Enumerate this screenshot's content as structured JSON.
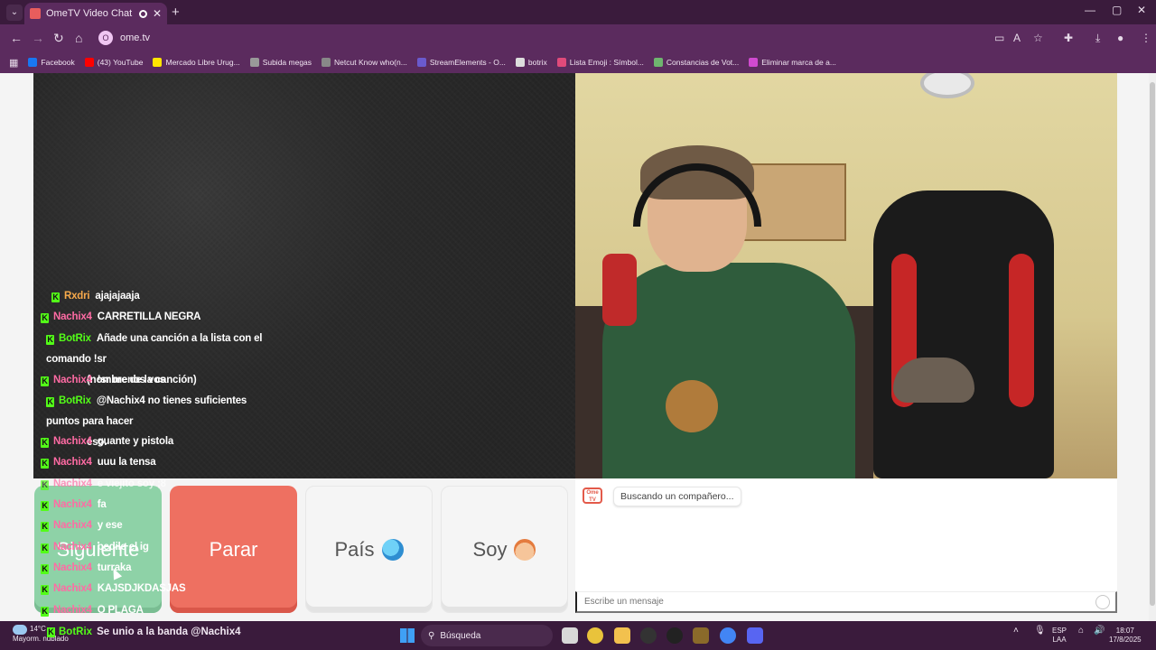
{
  "browser": {
    "tab_title": "OmeTV Video Chat — Ome",
    "tab_close": "✕",
    "new_tab": "+",
    "address": "ome.tv",
    "window_controls": {
      "minimize": "—",
      "maximize": "▢",
      "close": "✕"
    },
    "bookmarks": [
      {
        "label": "Facebook",
        "color": "#1877f2"
      },
      {
        "label": "(43) YouTube",
        "color": "#ff0000"
      },
      {
        "label": "Mercado Libre Urug...",
        "color": "#ffe600"
      },
      {
        "label": "Subida megas",
        "color": "#999999"
      },
      {
        "label": "Netcut Know who(n...",
        "color": "#888888"
      },
      {
        "label": "StreamElements - O...",
        "color": "#6a5acd"
      },
      {
        "label": "botrix",
        "color": "#dddddd"
      },
      {
        "label": "Lista Emoji : Símbol...",
        "color": "#e04a7a"
      },
      {
        "label": "Constancias de Vot...",
        "color": "#6fb46f"
      },
      {
        "label": "Eliminar marca de a...",
        "color": "#d04ad0"
      }
    ]
  },
  "chat_overlay": {
    "badge": "K",
    "messages": [
      {
        "user": "Rxdri",
        "color": "#f7a94b",
        "text": "ajajajaaja"
      },
      {
        "user": "Nachix4",
        "color": "#ff6ba4",
        "text": "CARRETILLA NEGRA"
      },
      {
        "user": "BotRix",
        "color": "#53fc18",
        "text": "Añade una canción a la lista con el comando !sr",
        "text2": "(nombre de la canción)"
      },
      {
        "user": "Nachix4",
        "color": "#ff6ba4",
        "text": "!sr menos vos"
      },
      {
        "user": "BotRix",
        "color": "#53fc18",
        "text": "@Nachix4 no tienes suficientes puntos para hacer",
        "text2": "eso."
      },
      {
        "user": "Nachix4",
        "color": "#ff6ba4",
        "text": "guante y pistola"
      },
      {
        "user": "Nachix4",
        "color": "#ff6ba4",
        "text": "uuu la tensa"
      },
      {
        "user": "Nachix4",
        "color": "#ff6ba4",
        "text": "e viejito soy ;8"
      },
      {
        "user": "Nachix4",
        "color": "#ff6ba4",
        "text": "fa"
      },
      {
        "user": "Nachix4",
        "color": "#ff6ba4",
        "text": "y ese"
      },
      {
        "user": "Nachix4",
        "color": "#ff6ba4",
        "text": "pedile el ig"
      },
      {
        "user": "Nachix4",
        "color": "#ff6ba4",
        "text": "turraka"
      },
      {
        "user": "Nachix4",
        "color": "#ff6ba4",
        "text": "KAJSDJKDASJAS"
      },
      {
        "user": "Nachix4",
        "color": "#ff6ba4",
        "text": "O PLAGA"
      }
    ]
  },
  "controls": {
    "next": "Siguiente",
    "stop": "Parar",
    "country": "País",
    "me": "Soy"
  },
  "chat_panel": {
    "logo": "Ome TV",
    "status": "Buscando un compañero...",
    "input_placeholder": "Escribe un mensaje"
  },
  "taskbar": {
    "weather_temp": "14°C",
    "weather_desc": "Mayorm. nublado",
    "ticker_badge": "K",
    "ticker_user": "BotRix",
    "ticker_text": "Se unio a la banda @Nachix4",
    "search": "Búsqueda",
    "lang": "ESP",
    "layout": "LAA",
    "time": "18:07",
    "date": "17/8/2025"
  }
}
